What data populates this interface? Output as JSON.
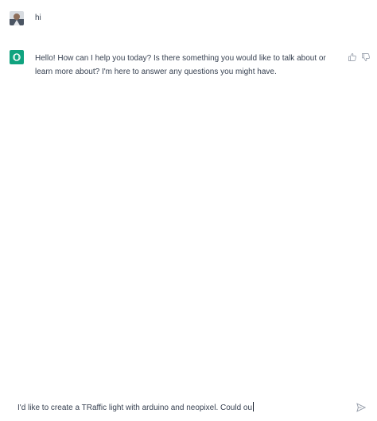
{
  "conversation": {
    "user_message": "hi",
    "assistant_message": "Hello! How can I help you today? Is there something you would like to talk about or learn more about? I'm here to answer any questions you might have.",
    "user_avatar_icon": "user-photo-avatar",
    "assistant_avatar_icon": "openai-logo-icon",
    "feedback_icons": [
      "thumbs-up-icon",
      "thumbs-down-icon"
    ]
  },
  "composer": {
    "value": "I'd like to create a TRaffic light with arduino and neopixel. Could ou",
    "send_icon": "send-icon"
  },
  "colors": {
    "assistant_accent": "#10a37f",
    "text": "#374151"
  }
}
